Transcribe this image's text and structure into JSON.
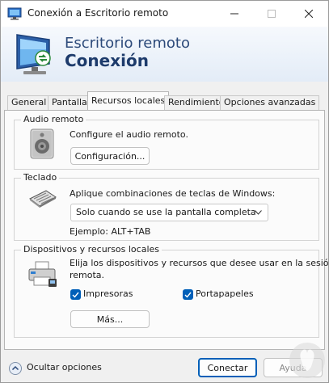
{
  "window": {
    "title": "Conexión a Escritorio remoto"
  },
  "banner": {
    "line1": "Escritorio remoto",
    "line2": "Conexión"
  },
  "tabs": [
    {
      "label": "General"
    },
    {
      "label": "Pantalla"
    },
    {
      "label": "Recursos locales",
      "active": true
    },
    {
      "label": "Rendimiento"
    },
    {
      "label": "Opciones avanzadas"
    }
  ],
  "audio": {
    "group_title": "Audio remoto",
    "description": "Configure el audio remoto.",
    "config_button": "Configuración..."
  },
  "keyboard": {
    "group_title": "Teclado",
    "description": "Aplique combinaciones de teclas de Windows:",
    "select_value": "Solo cuando se use la pantalla completa",
    "example": "Ejemplo: ALT+TAB"
  },
  "devices": {
    "group_title": "Dispositivos y recursos locales",
    "description_line1": "Elija los dispositivos y recursos que desee usar en la sesión",
    "description_line2": "remota.",
    "printers_label": "Impresoras",
    "printers_checked": true,
    "clipboard_label": "Portapapeles",
    "clipboard_checked": true,
    "more_button": "Más..."
  },
  "footer": {
    "hide_options": "Ocultar opciones",
    "connect_button": "Conectar",
    "help_button": "Ayuda"
  },
  "colors": {
    "accent": "#005fb8",
    "banner_title": "#1d3b6b"
  },
  "icons": {
    "app": "remote-desktop-icon",
    "audio": "speaker-icon",
    "keyboard": "keyboard-icon",
    "devices": "printer-icon",
    "toggle": "chevron-up-icon"
  }
}
